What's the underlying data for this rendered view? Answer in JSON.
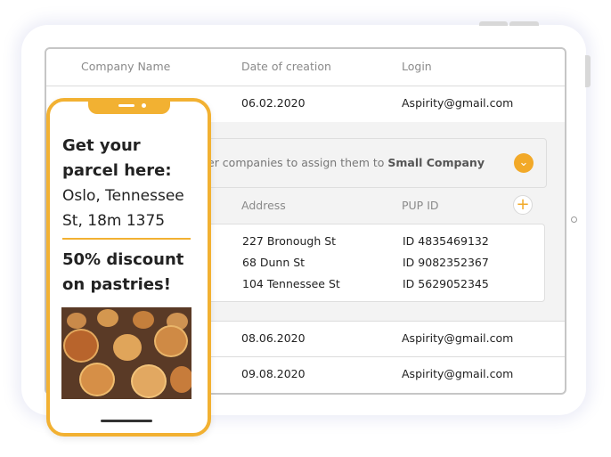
{
  "table": {
    "headers": {
      "company": "Company Name",
      "date": "Date of creation",
      "login": "Login"
    },
    "rows": [
      {
        "date": "06.02.2020",
        "login": "Aspirity@gmail.com"
      },
      {
        "date": "08.06.2020",
        "login": "Aspirity@gmail.com"
      },
      {
        "date": "09.08.2020",
        "login": "Aspirity@gmail.com"
      }
    ]
  },
  "expanded": {
    "assign_text": "er companies to assign them to",
    "assign_company": "Small Company",
    "sub_headers": {
      "address": "Address",
      "pup": "PUP ID"
    },
    "addresses": [
      {
        "address": "227 Bronough St",
        "pup": "ID 4835469132"
      },
      {
        "address": "68 Dunn St",
        "pup": "ID 9082352367"
      },
      {
        "address": "104 Tennessee St",
        "pup": "ID 5629052345"
      }
    ]
  },
  "phone": {
    "title": "Get your parcel here:",
    "address": "Oslo, Tennessee St, 18m 1375",
    "discount": "50% discount on pastries!"
  },
  "colors": {
    "accent": "#f2b132",
    "chevron": "#f2a928"
  },
  "icons": {
    "chevron": "chevron-down-icon",
    "add": "plus-icon"
  }
}
